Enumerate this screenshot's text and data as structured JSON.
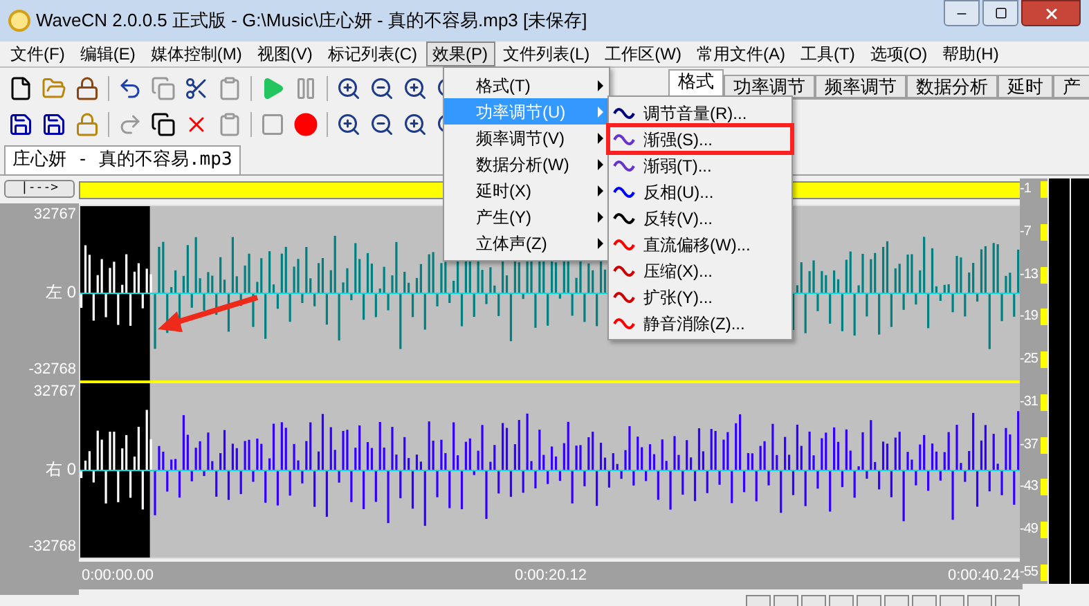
{
  "window": {
    "title": "WaveCN 2.0.0.5 正式版 - G:\\Music\\庄心妍 - 真的不容易.mp3 [未保存]"
  },
  "menu_bar": [
    {
      "label": "文件(F)",
      "selected": false
    },
    {
      "label": "编辑(E)",
      "selected": false
    },
    {
      "label": "媒体控制(M)",
      "selected": false
    },
    {
      "label": "视图(V)",
      "selected": false
    },
    {
      "label": "标记列表(C)",
      "selected": false
    },
    {
      "label": "效果(P)",
      "selected": true
    },
    {
      "label": "文件列表(L)",
      "selected": false
    },
    {
      "label": "工作区(W)",
      "selected": false
    },
    {
      "label": "常用文件(A)",
      "selected": false
    },
    {
      "label": "工具(T)",
      "selected": false
    },
    {
      "label": "选项(O)",
      "selected": false
    },
    {
      "label": "帮助(H)",
      "selected": false
    }
  ],
  "effect_tabs": [
    {
      "label": "格式",
      "selected": true
    },
    {
      "label": "功率调节",
      "selected": false
    },
    {
      "label": "频率调节",
      "selected": false
    },
    {
      "label": "数据分析",
      "selected": false
    },
    {
      "label": "延时",
      "selected": false
    },
    {
      "label": "产",
      "selected": false
    }
  ],
  "document_tabs": [
    {
      "label": "庄心妍 - 真的不容易.mp3",
      "selected": true
    }
  ],
  "effects_menu": [
    {
      "label": "格式(T)",
      "selected": false
    },
    {
      "label": "功率调节(U)",
      "selected": true
    },
    {
      "label": "频率调节(V)",
      "selected": false
    },
    {
      "label": "数据分析(W)",
      "selected": false
    },
    {
      "label": "延时(X)",
      "selected": false
    },
    {
      "label": "产生(Y)",
      "selected": false
    },
    {
      "label": "立体声(Z)",
      "selected": false
    }
  ],
  "power_submenu": [
    {
      "label": "调节音量(R)...",
      "marked": false
    },
    {
      "label": "渐强(S)...",
      "marked": true
    },
    {
      "label": "渐弱(T)...",
      "marked": false
    },
    {
      "label": "反相(U)...",
      "marked": false
    },
    {
      "label": "反转(V)...",
      "marked": false
    },
    {
      "label": "直流偏移(W)...",
      "marked": false
    },
    {
      "label": "压缩(X)...",
      "marked": false
    },
    {
      "label": "扩张(Y)...",
      "marked": false
    },
    {
      "label": "静音消除(Z)...",
      "marked": false
    }
  ],
  "editor": {
    "jump_button": "|--->",
    "channels": [
      {
        "label": "左 0",
        "max": "32767",
        "min": "-32768",
        "color": "#008080"
      },
      {
        "label": "右 0",
        "max": "32767",
        "min": "-32768",
        "color": "#3300ff"
      }
    ],
    "selection": {
      "level": 0.074
    },
    "time_labels": [
      "0:00:00.00",
      "0:00:20.12",
      "0:00:40.24"
    ],
    "meter_scale": [
      "-1",
      "-7",
      "-13",
      "-19",
      "-25",
      "-31",
      "-37",
      "-43",
      "-49",
      "-55"
    ]
  }
}
